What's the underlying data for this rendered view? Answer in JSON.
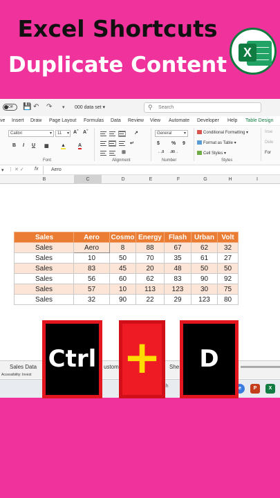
{
  "heading": {
    "line1": "Excel Shortcuts",
    "line2": "Duplicate Content",
    "logo_letter": "X"
  },
  "window": {
    "autosave_label": "Off",
    "doc_name": "000 data set",
    "search_placeholder": "Search"
  },
  "menu": {
    "tabs": [
      "ve",
      "Insert",
      "Draw",
      "Page Layout",
      "Formulas",
      "Data",
      "Review",
      "View",
      "Automate",
      "Developer",
      "Help",
      "Table Design"
    ],
    "active": "Table Design"
  },
  "ribbon": {
    "font_name": "Calibri",
    "font_size": "11",
    "number_format": "General",
    "conditional_formatting": "Conditional Formatting",
    "format_as_table": "Format as Table",
    "cell_styles": "Cell Styles",
    "groups": [
      "Font",
      "Alignment",
      "Number",
      "Styles"
    ],
    "right_items": [
      "Inse",
      "Dele",
      "For"
    ]
  },
  "formula_bar": {
    "fx": "fx",
    "content": "Aero"
  },
  "columns": [
    "B",
    "C",
    "D",
    "E",
    "F",
    "G",
    "H",
    "I"
  ],
  "selected_column": "C",
  "table": {
    "headers": [
      "Sales",
      "Aero",
      "Cosmo",
      "Energy",
      "Flash",
      "Urban",
      "Volt"
    ],
    "rows": [
      [
        "Sales",
        "Aero",
        "8",
        "88",
        "67",
        "62",
        "32"
      ],
      [
        "Sales",
        "10",
        "50",
        "70",
        "35",
        "61",
        "27"
      ],
      [
        "Sales",
        "83",
        "45",
        "20",
        "48",
        "50",
        "50"
      ],
      [
        "Sales",
        "56",
        "60",
        "62",
        "83",
        "90",
        "92"
      ],
      [
        "Sales",
        "57",
        "10",
        "113",
        "123",
        "30",
        "75"
      ],
      [
        "Sales",
        "32",
        "90",
        "22",
        "29",
        "123",
        "80"
      ]
    ],
    "header_color": "#ea7d33",
    "band_color": "#fce4d6"
  },
  "sheet_tabs": [
    "Sales Data",
    "ustom",
    "She"
  ],
  "status": {
    "accessibility": "Accessibility: Invest"
  },
  "taskbar": {
    "search_label": "earch"
  },
  "keys": {
    "key1": "Ctrl",
    "plus": "+",
    "key2": "D"
  }
}
